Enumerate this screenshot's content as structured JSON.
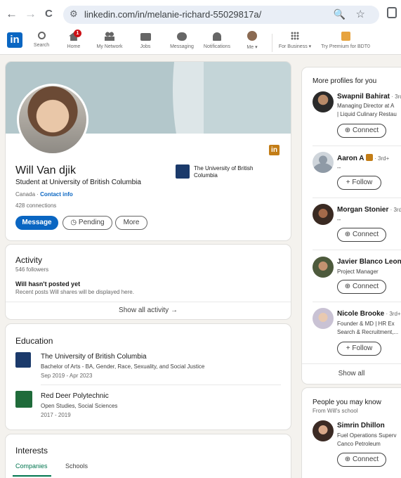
{
  "browser": {
    "back": "←",
    "forward": "→",
    "reload": "C",
    "url": "linkedin.com/in/melanie-richard-55029817a/"
  },
  "nav": {
    "logo": "in",
    "items": [
      {
        "label": "Search"
      },
      {
        "label": "Home",
        "badge": "1"
      },
      {
        "label": "My Network"
      },
      {
        "label": "Jobs"
      },
      {
        "label": "Messaging"
      },
      {
        "label": "Notifications"
      },
      {
        "label": "Me ▾"
      },
      {
        "label": "For Business ▾"
      },
      {
        "label": "Try Premium for BDT0"
      }
    ]
  },
  "profile": {
    "name": "Will Van djik",
    "headline": "Student at University of British Columbia",
    "location": "Canada · ",
    "contact_info": "Contact info",
    "connections": "428 connections",
    "school": "The University of British Columbia",
    "li_badge": "in",
    "buttons": {
      "message": "Message",
      "pending": "Pending",
      "more": "More"
    }
  },
  "activity": {
    "title": "Activity",
    "followers": "546 followers",
    "empty_title": "Will hasn't posted yet",
    "empty_desc": "Recent posts Will shares will be displayed here.",
    "show_all": "Show all activity →"
  },
  "education": {
    "title": "Education",
    "items": [
      {
        "school": "The University of British Columbia",
        "degree": "Bachelor of Arts - BA, Gender, Race, Sexuality, and Social Justice",
        "dates": "Sep 2019 - Apr 2023"
      },
      {
        "school": "Red Deer Polytechnic",
        "degree": "Open Studies, Social Sciences",
        "dates": "2017 - 2019"
      }
    ]
  },
  "interests": {
    "title": "Interests",
    "tabs": [
      "Companies",
      "Schools"
    ]
  },
  "more_profiles": {
    "title": "More profiles for you",
    "people": [
      {
        "name": "Swapnil Bahirat",
        "degree": " · 3rd",
        "desc1": "Managing Director at A",
        "desc2": "| Liquid Culinary Restau",
        "action": "Connect"
      },
      {
        "name": "Aaron A",
        "degree": " · 3rd+",
        "desc1": "--",
        "desc2": "",
        "action": "Follow"
      },
      {
        "name": "Morgan Stonier",
        "degree": " · 3rd",
        "desc1": "--",
        "desc2": "",
        "action": "Connect"
      },
      {
        "name": "Javier Blanco Leon",
        "degree": " ·",
        "desc1": "Project Manager",
        "desc2": "",
        "action": "Connect"
      },
      {
        "name": "Nicole Brooke",
        "degree": " · 3rd+",
        "desc1": "Founder & MD | HR Ex",
        "desc2": "Search & Recruitment,...",
        "action": "Follow"
      }
    ],
    "show_all": "Show all"
  },
  "people_know": {
    "title": "People you may know",
    "subtitle": "From Will's school",
    "person": {
      "name": "Simrin Dhillon",
      "desc1": "Fuel Operations Superv",
      "desc2": "Canco Petroleum",
      "action": "Connect"
    }
  }
}
